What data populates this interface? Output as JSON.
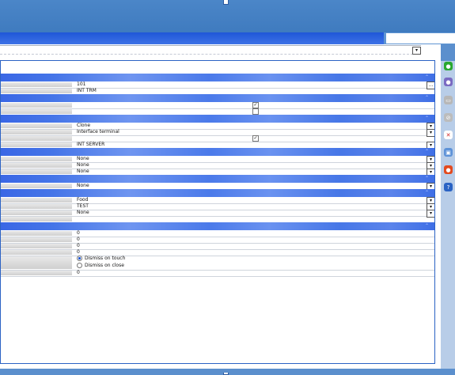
{
  "toolbar": {
    "icons": [
      "add-icon",
      "save-icon",
      "list-icon",
      "disabled-icon",
      "delete-icon",
      "copy-icon",
      "stop-icon",
      "help-icon"
    ],
    "colors": {
      "accent": "#3f74e8",
      "titlebar": "#4b86c8"
    }
  },
  "form": {
    "sections": [
      {
        "fields": [
          {
            "type": "text",
            "value": "101",
            "button": "..."
          },
          {
            "type": "text",
            "value": "INT TRM"
          }
        ]
      },
      {
        "fields": [
          {
            "type": "checkbox",
            "checked": true
          },
          {
            "type": "checkbox",
            "checked": false
          }
        ]
      },
      {
        "fields": [
          {
            "type": "select",
            "value": "Clone"
          },
          {
            "type": "select",
            "value": "Interface terminal"
          },
          {
            "type": "checkbox",
            "checked": true
          },
          {
            "type": "select",
            "value": "INT SERVER"
          }
        ]
      },
      {
        "fields": [
          {
            "type": "select",
            "value": "None"
          },
          {
            "type": "select",
            "value": "None"
          },
          {
            "type": "select",
            "value": "None"
          }
        ]
      },
      {
        "fields": [
          {
            "type": "select",
            "value": "None"
          }
        ]
      },
      {
        "fields": [
          {
            "type": "select",
            "value": "Food"
          },
          {
            "type": "select",
            "value": "TEST"
          },
          {
            "type": "select",
            "value": "None"
          },
          {
            "type": "text",
            "value": ""
          }
        ]
      },
      {
        "fields": [
          {
            "type": "text",
            "value": "0"
          },
          {
            "type": "text",
            "value": "0"
          },
          {
            "type": "text",
            "value": "0"
          },
          {
            "type": "text",
            "value": "0"
          },
          {
            "type": "radio",
            "options": [
              "Dismiss on touch",
              "Dismiss on close"
            ],
            "selected": 0
          },
          {
            "type": "text",
            "value": "0"
          }
        ]
      }
    ]
  }
}
